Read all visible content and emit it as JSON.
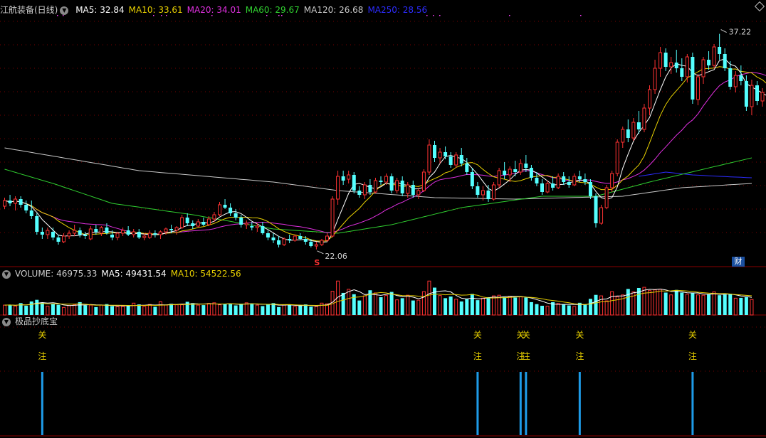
{
  "header": {
    "stock_title": "江航装备(日线)",
    "ma_items": [
      {
        "text": "MA5: 32.84",
        "color": "#ffffff"
      },
      {
        "text": "MA10: 33.61",
        "color": "#e8d000"
      },
      {
        "text": "MA20: 34.01",
        "color": "#e030e0"
      },
      {
        "text": "MA60: 29.67",
        "color": "#30d030"
      },
      {
        "text": "MA120: 26.68",
        "color": "#c8c8c8"
      },
      {
        "text": "MA250: 28.56",
        "color": "#2c2cff"
      }
    ]
  },
  "volume_header": [
    {
      "text": "VOLUME: 46975.33",
      "color": "#cccccc"
    },
    {
      "text": "MA5: 49431.54",
      "color": "#ffffff"
    },
    {
      "text": "MA10: 54522.56",
      "color": "#e8d000"
    }
  ],
  "indicator": {
    "title": "极品抄底宝",
    "signal_char1": "关",
    "signal_char2": "注"
  },
  "badge": {
    "cai": "财",
    "s_mark": "S"
  },
  "colors": {
    "up": "#ff3232",
    "down": "#54ffff",
    "grid": "#7a0000",
    "signal": "#1e9be8"
  },
  "chart_data": {
    "type": "candlestick",
    "price_ylim": [
      21.1,
      38.6
    ],
    "high_label": "37.22",
    "low_label": "22.06",
    "candles": [
      {
        "o": 25.1,
        "h": 25.7,
        "l": 24.9,
        "c": 25.5
      },
      {
        "o": 25.5,
        "h": 25.9,
        "l": 25.1,
        "c": 25.3
      },
      {
        "o": 25.3,
        "h": 25.8,
        "l": 24.8,
        "c": 25.6
      },
      {
        "o": 25.6,
        "h": 25.8,
        "l": 25.0,
        "c": 25.2
      },
      {
        "o": 25.2,
        "h": 25.5,
        "l": 24.6,
        "c": 24.8
      },
      {
        "o": 24.8,
        "h": 25.5,
        "l": 24.2,
        "c": 24.4
      },
      {
        "o": 24.4,
        "h": 24.6,
        "l": 23.1,
        "c": 23.3
      },
      {
        "o": 23.3,
        "h": 23.6,
        "l": 22.8,
        "c": 23.1
      },
      {
        "o": 23.1,
        "h": 23.6,
        "l": 22.8,
        "c": 23.4
      },
      {
        "o": 23.3,
        "h": 23.6,
        "l": 22.7,
        "c": 22.9
      },
      {
        "o": 22.9,
        "h": 23.1,
        "l": 22.4,
        "c": 22.6
      },
      {
        "o": 22.6,
        "h": 23.2,
        "l": 22.5,
        "c": 23.0
      },
      {
        "o": 23.0,
        "h": 23.4,
        "l": 22.8,
        "c": 23.2
      },
      {
        "o": 23.2,
        "h": 23.8,
        "l": 23.0,
        "c": 23.4
      },
      {
        "o": 23.4,
        "h": 23.6,
        "l": 22.9,
        "c": 23.1
      },
      {
        "o": 23.1,
        "h": 23.3,
        "l": 22.8,
        "c": 23.0
      },
      {
        "o": 22.8,
        "h": 23.7,
        "l": 22.7,
        "c": 23.5
      },
      {
        "o": 23.5,
        "h": 23.8,
        "l": 23.1,
        "c": 23.3
      },
      {
        "o": 23.2,
        "h": 23.7,
        "l": 23.0,
        "c": 23.6
      },
      {
        "o": 23.6,
        "h": 23.9,
        "l": 23.1,
        "c": 23.2
      },
      {
        "o": 23.1,
        "h": 23.4,
        "l": 22.7,
        "c": 22.9
      },
      {
        "o": 22.9,
        "h": 23.3,
        "l": 22.7,
        "c": 23.2
      },
      {
        "o": 23.2,
        "h": 23.6,
        "l": 23.0,
        "c": 23.4
      },
      {
        "o": 23.4,
        "h": 23.7,
        "l": 23.0,
        "c": 23.1
      },
      {
        "o": 23.1,
        "h": 23.5,
        "l": 22.9,
        "c": 23.3
      },
      {
        "o": 23.3,
        "h": 23.5,
        "l": 22.8,
        "c": 22.9
      },
      {
        "o": 22.9,
        "h": 23.2,
        "l": 22.7,
        "c": 23.0
      },
      {
        "o": 22.9,
        "h": 23.4,
        "l": 22.8,
        "c": 23.2
      },
      {
        "o": 23.2,
        "h": 23.4,
        "l": 22.9,
        "c": 23.1
      },
      {
        "o": 23.1,
        "h": 23.4,
        "l": 22.8,
        "c": 23.3
      },
      {
        "o": 23.3,
        "h": 23.6,
        "l": 23.1,
        "c": 23.5
      },
      {
        "o": 23.5,
        "h": 23.8,
        "l": 23.2,
        "c": 23.4
      },
      {
        "o": 23.4,
        "h": 23.7,
        "l": 23.1,
        "c": 23.6
      },
      {
        "o": 23.6,
        "h": 24.5,
        "l": 23.5,
        "c": 24.3
      },
      {
        "o": 24.3,
        "h": 24.6,
        "l": 23.7,
        "c": 23.9
      },
      {
        "o": 23.9,
        "h": 24.1,
        "l": 23.5,
        "c": 23.7
      },
      {
        "o": 23.7,
        "h": 24.2,
        "l": 23.6,
        "c": 24.0
      },
      {
        "o": 24.0,
        "h": 24.3,
        "l": 23.7,
        "c": 23.8
      },
      {
        "o": 23.8,
        "h": 24.4,
        "l": 23.7,
        "c": 24.2
      },
      {
        "o": 24.2,
        "h": 24.7,
        "l": 24.0,
        "c": 24.5
      },
      {
        "o": 24.5,
        "h": 25.4,
        "l": 24.4,
        "c": 25.2
      },
      {
        "o": 25.2,
        "h": 25.6,
        "l": 24.9,
        "c": 25.0
      },
      {
        "o": 25.0,
        "h": 25.3,
        "l": 24.4,
        "c": 24.6
      },
      {
        "o": 24.6,
        "h": 24.9,
        "l": 24.1,
        "c": 24.3
      },
      {
        "o": 24.3,
        "h": 24.5,
        "l": 23.6,
        "c": 23.8
      },
      {
        "o": 23.8,
        "h": 24.1,
        "l": 23.5,
        "c": 23.9
      },
      {
        "o": 23.7,
        "h": 24.0,
        "l": 23.4,
        "c": 23.6
      },
      {
        "o": 23.6,
        "h": 23.9,
        "l": 23.3,
        "c": 23.7
      },
      {
        "o": 23.7,
        "h": 24.0,
        "l": 23.1,
        "c": 23.2
      },
      {
        "o": 23.2,
        "h": 23.4,
        "l": 22.7,
        "c": 22.9
      },
      {
        "o": 22.9,
        "h": 23.2,
        "l": 22.5,
        "c": 22.7
      },
      {
        "o": 22.7,
        "h": 23.0,
        "l": 22.2,
        "c": 22.4
      },
      {
        "o": 22.4,
        "h": 22.9,
        "l": 22.3,
        "c": 22.8
      },
      {
        "o": 22.8,
        "h": 23.1,
        "l": 22.5,
        "c": 22.7
      },
      {
        "o": 22.7,
        "h": 23.1,
        "l": 22.6,
        "c": 23.0
      },
      {
        "o": 23.0,
        "h": 23.2,
        "l": 22.7,
        "c": 22.8
      },
      {
        "o": 22.8,
        "h": 23.0,
        "l": 22.4,
        "c": 22.6
      },
      {
        "o": 22.6,
        "h": 22.8,
        "l": 22.2,
        "c": 22.3
      },
      {
        "o": 22.3,
        "h": 22.6,
        "l": 22.06,
        "c": 22.4
      },
      {
        "o": 22.4,
        "h": 22.8,
        "l": 22.3,
        "c": 22.7
      },
      {
        "o": 22.7,
        "h": 23.2,
        "l": 22.6,
        "c": 23.0
      },
      {
        "o": 23.0,
        "h": 25.8,
        "l": 22.9,
        "c": 25.6
      },
      {
        "o": 25.6,
        "h": 27.6,
        "l": 25.2,
        "c": 27.2
      },
      {
        "o": 27.2,
        "h": 27.6,
        "l": 26.6,
        "c": 26.9
      },
      {
        "o": 27.0,
        "h": 27.6,
        "l": 26.7,
        "c": 27.3
      },
      {
        "o": 27.3,
        "h": 27.5,
        "l": 26.0,
        "c": 26.2
      },
      {
        "o": 26.2,
        "h": 26.5,
        "l": 25.7,
        "c": 25.9
      },
      {
        "o": 25.9,
        "h": 26.8,
        "l": 25.6,
        "c": 26.6
      },
      {
        "o": 26.6,
        "h": 27.0,
        "l": 25.9,
        "c": 26.1
      },
      {
        "o": 26.1,
        "h": 27.1,
        "l": 26.0,
        "c": 26.9
      },
      {
        "o": 26.9,
        "h": 27.2,
        "l": 26.6,
        "c": 26.8
      },
      {
        "o": 26.8,
        "h": 27.4,
        "l": 26.6,
        "c": 27.2
      },
      {
        "o": 27.2,
        "h": 27.4,
        "l": 26.0,
        "c": 26.2
      },
      {
        "o": 26.2,
        "h": 27.1,
        "l": 26.0,
        "c": 26.9
      },
      {
        "o": 26.9,
        "h": 27.2,
        "l": 25.8,
        "c": 26.0
      },
      {
        "o": 26.0,
        "h": 26.8,
        "l": 25.7,
        "c": 26.6
      },
      {
        "o": 26.6,
        "h": 26.9,
        "l": 25.7,
        "c": 25.9
      },
      {
        "o": 25.9,
        "h": 26.4,
        "l": 25.6,
        "c": 26.2
      },
      {
        "o": 26.2,
        "h": 27.7,
        "l": 26.1,
        "c": 27.5
      },
      {
        "o": 27.5,
        "h": 29.8,
        "l": 27.3,
        "c": 29.4
      },
      {
        "o": 29.4,
        "h": 29.7,
        "l": 28.2,
        "c": 28.5
      },
      {
        "o": 28.5,
        "h": 29.2,
        "l": 28.1,
        "c": 28.9
      },
      {
        "o": 28.9,
        "h": 29.3,
        "l": 28.4,
        "c": 28.6
      },
      {
        "o": 28.6,
        "h": 28.9,
        "l": 27.8,
        "c": 28.0
      },
      {
        "o": 28.0,
        "h": 28.9,
        "l": 27.8,
        "c": 28.7
      },
      {
        "o": 28.7,
        "h": 29.2,
        "l": 27.9,
        "c": 28.1
      },
      {
        "o": 28.1,
        "h": 28.5,
        "l": 27.3,
        "c": 27.5
      },
      {
        "o": 27.5,
        "h": 27.8,
        "l": 26.3,
        "c": 26.5
      },
      {
        "o": 26.5,
        "h": 26.8,
        "l": 25.7,
        "c": 25.9
      },
      {
        "o": 25.9,
        "h": 26.5,
        "l": 25.5,
        "c": 26.2
      },
      {
        "o": 26.2,
        "h": 26.6,
        "l": 25.4,
        "c": 25.6
      },
      {
        "o": 25.6,
        "h": 26.8,
        "l": 25.5,
        "c": 26.6
      },
      {
        "o": 26.6,
        "h": 27.8,
        "l": 26.4,
        "c": 27.6
      },
      {
        "o": 27.6,
        "h": 28.2,
        "l": 27.0,
        "c": 27.3
      },
      {
        "o": 27.3,
        "h": 27.9,
        "l": 26.8,
        "c": 27.7
      },
      {
        "o": 27.7,
        "h": 28.3,
        "l": 27.2,
        "c": 27.5
      },
      {
        "o": 27.5,
        "h": 28.4,
        "l": 27.3,
        "c": 28.1
      },
      {
        "o": 28.1,
        "h": 28.7,
        "l": 27.5,
        "c": 27.8
      },
      {
        "o": 27.8,
        "h": 28.0,
        "l": 26.9,
        "c": 27.1
      },
      {
        "o": 27.1,
        "h": 27.5,
        "l": 26.5,
        "c": 26.7
      },
      {
        "o": 26.7,
        "h": 27.0,
        "l": 25.9,
        "c": 26.1
      },
      {
        "o": 26.1,
        "h": 26.9,
        "l": 26.0,
        "c": 26.7
      },
      {
        "o": 26.7,
        "h": 27.2,
        "l": 26.2,
        "c": 26.4
      },
      {
        "o": 26.4,
        "h": 27.4,
        "l": 26.3,
        "c": 27.2
      },
      {
        "o": 27.2,
        "h": 27.5,
        "l": 26.6,
        "c": 26.8
      },
      {
        "o": 26.8,
        "h": 27.2,
        "l": 26.4,
        "c": 26.6
      },
      {
        "o": 26.6,
        "h": 27.4,
        "l": 26.5,
        "c": 27.2
      },
      {
        "o": 27.2,
        "h": 27.6,
        "l": 26.8,
        "c": 27.0
      },
      {
        "o": 27.0,
        "h": 27.4,
        "l": 26.6,
        "c": 26.8
      },
      {
        "o": 26.8,
        "h": 27.0,
        "l": 25.6,
        "c": 25.8
      },
      {
        "o": 25.8,
        "h": 26.0,
        "l": 23.6,
        "c": 23.9
      },
      {
        "o": 23.9,
        "h": 25.2,
        "l": 23.8,
        "c": 25.0
      },
      {
        "o": 25.0,
        "h": 26.6,
        "l": 24.9,
        "c": 26.4
      },
      {
        "o": 26.4,
        "h": 27.6,
        "l": 26.1,
        "c": 27.4
      },
      {
        "o": 27.4,
        "h": 29.8,
        "l": 27.2,
        "c": 29.6
      },
      {
        "o": 29.6,
        "h": 30.7,
        "l": 29.2,
        "c": 30.5
      },
      {
        "o": 30.5,
        "h": 31.2,
        "l": 29.6,
        "c": 29.9
      },
      {
        "o": 29.9,
        "h": 31.3,
        "l": 29.7,
        "c": 31.0
      },
      {
        "o": 31.0,
        "h": 31.8,
        "l": 30.2,
        "c": 30.5
      },
      {
        "o": 30.5,
        "h": 32.3,
        "l": 30.3,
        "c": 32.0
      },
      {
        "o": 32.0,
        "h": 33.6,
        "l": 31.5,
        "c": 33.3
      },
      {
        "o": 33.3,
        "h": 35.4,
        "l": 33.0,
        "c": 34.8
      },
      {
        "o": 34.8,
        "h": 36.3,
        "l": 34.2,
        "c": 35.9
      },
      {
        "o": 35.9,
        "h": 36.2,
        "l": 34.6,
        "c": 34.9
      },
      {
        "o": 34.9,
        "h": 35.6,
        "l": 34.4,
        "c": 35.2
      },
      {
        "o": 35.2,
        "h": 36.1,
        "l": 34.5,
        "c": 34.8
      },
      {
        "o": 34.8,
        "h": 35.5,
        "l": 33.9,
        "c": 34.2
      },
      {
        "o": 34.2,
        "h": 35.8,
        "l": 33.8,
        "c": 35.6
      },
      {
        "o": 35.6,
        "h": 35.9,
        "l": 32.3,
        "c": 32.6
      },
      {
        "o": 32.6,
        "h": 34.4,
        "l": 32.2,
        "c": 34.2
      },
      {
        "o": 34.2,
        "h": 35.6,
        "l": 33.7,
        "c": 35.4
      },
      {
        "o": 35.4,
        "h": 36.0,
        "l": 34.7,
        "c": 35.0
      },
      {
        "o": 35.0,
        "h": 36.5,
        "l": 34.8,
        "c": 36.3
      },
      {
        "o": 36.3,
        "h": 37.22,
        "l": 35.4,
        "c": 35.8
      },
      {
        "o": 35.8,
        "h": 36.2,
        "l": 34.6,
        "c": 34.8
      },
      {
        "o": 34.8,
        "h": 35.3,
        "l": 33.3,
        "c": 33.5
      },
      {
        "o": 33.5,
        "h": 34.6,
        "l": 33.1,
        "c": 34.3
      },
      {
        "o": 34.3,
        "h": 35.0,
        "l": 33.6,
        "c": 33.9
      },
      {
        "o": 33.9,
        "h": 34.3,
        "l": 31.8,
        "c": 32.1
      },
      {
        "o": 32.1,
        "h": 34.0,
        "l": 31.5,
        "c": 33.6
      },
      {
        "o": 33.6,
        "h": 33.9,
        "l": 32.2,
        "c": 32.5
      },
      {
        "o": 32.5,
        "h": 33.4,
        "l": 32.1,
        "c": 33.1
      },
      {
        "o": 33.1,
        "h": 35.2,
        "l": 32.6,
        "c": 32.9
      },
      {
        "o": 32.9,
        "h": 33.5,
        "l": 31.6,
        "c": 31.8
      },
      {
        "o": 31.8,
        "h": 33.2,
        "l": 31.4,
        "c": 32.6
      },
      {
        "o": 32.6,
        "h": 33.3,
        "l": 32.0,
        "c": 32.3
      },
      {
        "o": 32.3,
        "h": 32.7,
        "l": 30.9,
        "c": 31.3
      }
    ],
    "ma120_anchor_points": [
      [
        0,
        29.2
      ],
      [
        25,
        27.6
      ],
      [
        50,
        26.8
      ],
      [
        62,
        26.2
      ],
      [
        80,
        25.7
      ],
      [
        95,
        25.6
      ],
      [
        105,
        25.7
      ],
      [
        115,
        25.8
      ],
      [
        126,
        26.4
      ],
      [
        139,
        26.7
      ]
    ],
    "ma250_anchor_points": [
      [
        118,
        27.2
      ],
      [
        123,
        27.5
      ],
      [
        128,
        27.3
      ],
      [
        133,
        27.2
      ],
      [
        139,
        27.1
      ]
    ],
    "ma60_anchor_points": [
      [
        0,
        27.7
      ],
      [
        9,
        26.7
      ],
      [
        20,
        25.3
      ],
      [
        35,
        24.5
      ],
      [
        50,
        23.5
      ],
      [
        62,
        23.2
      ],
      [
        72,
        23.8
      ],
      [
        85,
        25.0
      ],
      [
        100,
        25.8
      ],
      [
        110,
        25.8
      ],
      [
        120,
        26.8
      ],
      [
        130,
        27.7
      ],
      [
        139,
        28.5
      ]
    ],
    "volume": [
      3.0,
      3.1,
      2.7,
      3.6,
      2.8,
      4.1,
      4.6,
      3.8,
      2.7,
      3.3,
      3.1,
      2.3,
      2.9,
      3.1,
      3.9,
      2.9,
      3.0,
      2.4,
      3.0,
      3.3,
      2.7,
      2.5,
      2.6,
      2.9,
      3.6,
      3.2,
      2.6,
      3.2,
      2.5,
      4.0,
      3.0,
      3.4,
      3.1,
      3.1,
      4.0,
      3.6,
      3.0,
      3.0,
      3.5,
      3.7,
      3.1,
      3.4,
      3.4,
      2.9,
      3.4,
      3.7,
      3.5,
      3.0,
      2.7,
      3.3,
      3.6,
      2.4,
      3.0,
      3.1,
      2.6,
      2.9,
      3.2,
      2.5,
      2.6,
      3.6,
      3.4,
      7.2,
      10.3,
      6.7,
      7.8,
      6.3,
      4.4,
      5.8,
      7.5,
      6.7,
      5.4,
      5.9,
      7.0,
      4.6,
      5.1,
      6.0,
      4.4,
      4.5,
      7.1,
      10.3,
      8.3,
      5.9,
      5.1,
      5.6,
      4.8,
      4.1,
      4.8,
      6.4,
      4.5,
      5.1,
      5.4,
      5.8,
      6.0,
      5.4,
      5.7,
      5.3,
      5.6,
      5.3,
      3.9,
      3.3,
      2.8,
      2.7,
      3.9,
      3.5,
      3.2,
      2.9,
      2.6,
      3.7,
      3.2,
      4.9,
      6.1,
      5.8,
      4.3,
      7.1,
      5.5,
      6.1,
      7.9,
      7.0,
      8.2,
      8.4,
      7.4,
      7.6,
      7.8,
      6.8,
      6.1,
      7.6,
      6.8,
      6.3,
      6.6,
      6.1,
      6.0,
      6.3,
      7.0,
      6.0,
      6.2,
      6.3,
      5.1,
      5.2,
      5.4,
      4.7
    ],
    "volume_ylim": [
      0,
      11.0
    ],
    "signal_indices": [
      7,
      88,
      96,
      97,
      107,
      128
    ]
  }
}
